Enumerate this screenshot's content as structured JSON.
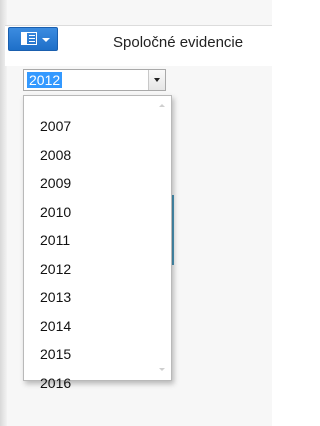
{
  "header": {
    "tab_title": "Spoločné evidencie"
  },
  "year_combo": {
    "selected": "2012",
    "options": [
      "2007",
      "2008",
      "2009",
      "2010",
      "2011",
      "2012",
      "2013",
      "2014",
      "2015",
      "2016"
    ]
  },
  "colors": {
    "accent": "#2a7fb8",
    "menu_button": "#1e6fc8",
    "selection": "#3399ff"
  }
}
